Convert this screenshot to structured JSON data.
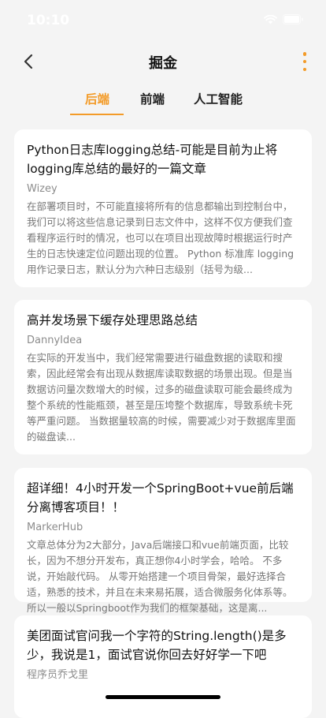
{
  "status_bar": {
    "time": "10:10"
  },
  "header": {
    "title": "掘金",
    "back_icon": "chevron-left-icon",
    "more_icon": "more-vertical-icon"
  },
  "colors": {
    "accent": "#f39b28",
    "background": "#f4f4f4",
    "card": "#ffffff"
  },
  "tabs": [
    {
      "label": "后端",
      "active": true
    },
    {
      "label": "前端",
      "active": false
    },
    {
      "label": "人工智能",
      "active": false
    }
  ],
  "articles": [
    {
      "title": "Python日志库logging总结-可能是目前为止将logging库总结的最好的一篇文章",
      "author": "Wizey",
      "summary": "在部署项目时，不可能直接将所有的信息都输出到控制台中，我们可以将这些信息记录到日志文件中，这样不仅方便我们查看程序运行时的情况，也可以在项目出现故障时根据运行时产生的日志快速定位问题出现的位置。 Python 标准库 logging 用作记录日志，默认分为六种日志级别（括号为级..."
    },
    {
      "title": "高并发场景下缓存处理思路总结",
      "author": "DannyIdea",
      "summary": "在实际的开发当中，我们经常需要进行磁盘数据的读取和搜索，因此经常会有出现从数据库读取数据的场景出现。但是当数据访问量次数增大的时候，过多的磁盘读取可能会最终成为整个系统的性能瓶颈，甚至是压垮整个数据库，导致系统卡死等严重问题。 当数据量较高的时候，需要减少对于数据库里面的磁盘读..."
    },
    {
      "title": "超详细！4小时开发一个SpringBoot+vue前后端分离博客项目！！",
      "author": "MarkerHub",
      "summary": "文章总体分为2大部分，Java后端接口和vue前端页面，比较长，因为不想分开发布，真正想你4小时学会，哈哈。 不多说，开始敲代码。 从零开始搭建一个项目骨架，最好选择合适，熟悉的技术，并且在未来易拓展，适合微服务化体系等。所以一般以Springboot作为我们的框架基础，这是离..."
    },
    {
      "title": "美团面试官问我一个字符的String.length()是多少，我说是1，面试官说你回去好好学一下吧",
      "author": "程序员乔戈里",
      "summary": ""
    }
  ]
}
